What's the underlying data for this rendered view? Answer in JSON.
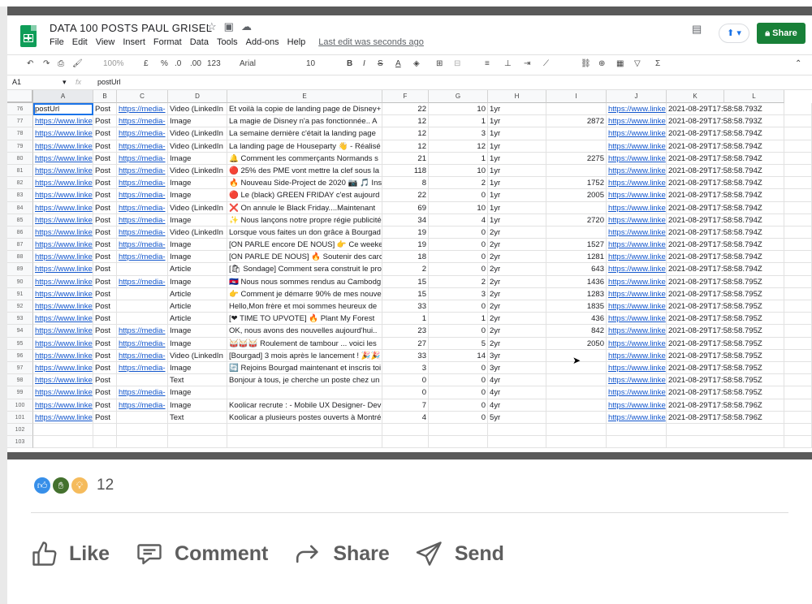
{
  "sheet": {
    "title": "DATA 100 POSTS PAUL GRISEL",
    "menu": [
      "File",
      "Edit",
      "View",
      "Insert",
      "Format",
      "Data",
      "Tools",
      "Add-ons",
      "Help"
    ],
    "last_edit": "Last edit was seconds ago",
    "share_label": "Share",
    "toolbar": {
      "zoom": "100%",
      "currency": "£",
      "percent": "%",
      "dec_less": ".0",
      "dec_more": ".00",
      "format": "123",
      "font": "Arial",
      "size": "10"
    },
    "cell_ref": "A1",
    "formula": "postUrl",
    "columns": [
      "A",
      "B",
      "C",
      "D",
      "E",
      "F",
      "G",
      "H",
      "I",
      "J",
      "K",
      "L"
    ],
    "rows": [
      {
        "n": "76",
        "a": "postUrl",
        "b": "Post",
        "c": "https://media-",
        "d": "Video (LinkedIn",
        "e": "Et voilà la copie de landing page de Disney+",
        "f": "22",
        "g": "10",
        "h": "1yr",
        "i": "",
        "j": "https://www.linke",
        "k": "2021-08-29T17:58:58.793Z"
      },
      {
        "n": "77",
        "a": "https://www.linke",
        "b": "Post",
        "c": "https://media-",
        "d": "Image",
        "e": "La magie de Disney n'a pas fonctionnée.. A",
        "f": "12",
        "g": "1",
        "h": "1yr",
        "i": "2872",
        "j": "https://www.linke",
        "k": "2021-08-29T17:58:58.793Z"
      },
      {
        "n": "78",
        "a": "https://www.linke",
        "b": "Post",
        "c": "https://media-",
        "d": "Video (LinkedIn",
        "e": "La semaine dernière c'était la landing page",
        "f": "12",
        "g": "3",
        "h": "1yr",
        "i": "",
        "j": "https://www.linke",
        "k": "2021-08-29T17:58:58.794Z"
      },
      {
        "n": "79",
        "a": "https://www.linke",
        "b": "Post",
        "c": "https://media-",
        "d": "Video (LinkedIn",
        "e": "La landing page de Houseparty 👋 - Réalisé",
        "f": "12",
        "g": "12",
        "h": "1yr",
        "i": "",
        "j": "https://www.linke",
        "k": "2021-08-29T17:58:58.794Z"
      },
      {
        "n": "80",
        "a": "https://www.linke",
        "b": "Post",
        "c": "https://media-",
        "d": "Image",
        "e": "🔔 Comment les commerçants Normands s",
        "f": "21",
        "g": "1",
        "h": "1yr",
        "i": "2275",
        "j": "https://www.linke",
        "k": "2021-08-29T17:58:58.794Z"
      },
      {
        "n": "81",
        "a": "https://www.linke",
        "b": "Post",
        "c": "https://media-",
        "d": "Video (LinkedIn",
        "e": "🔴 25% des PME vont mettre la clef sous la",
        "f": "118",
        "g": "10",
        "h": "1yr",
        "i": "",
        "j": "https://www.linke",
        "k": "2021-08-29T17:58:58.794Z"
      },
      {
        "n": "82",
        "a": "https://www.linke",
        "b": "Post",
        "c": "https://media-",
        "d": "Image",
        "e": "🔥 Nouveau Side-Project de 2020 📷 🎵 Ins",
        "f": "8",
        "g": "2",
        "h": "1yr",
        "i": "1752",
        "j": "https://www.linke",
        "k": "2021-08-29T17:58:58.794Z"
      },
      {
        "n": "83",
        "a": "https://www.linke",
        "b": "Post",
        "c": "https://media-",
        "d": "Image",
        "e": "🔴 Le (black) GREEN FRIDAY c'est aujourd",
        "f": "22",
        "g": "0",
        "h": "1yr",
        "i": "2005",
        "j": "https://www.linke",
        "k": "2021-08-29T17:58:58.794Z"
      },
      {
        "n": "84",
        "a": "https://www.linke",
        "b": "Post",
        "c": "https://media-",
        "d": "Video (LinkedIn",
        "e": "❌ On annule le Black Friday....Maintenant",
        "f": "69",
        "g": "10",
        "h": "1yr",
        "i": "",
        "j": "https://www.linke",
        "k": "2021-08-29T17:58:58.794Z"
      },
      {
        "n": "85",
        "a": "https://www.linke",
        "b": "Post",
        "c": "https://media-",
        "d": "Image",
        "e": "✨ Nous lançons notre propre régie publicité",
        "f": "34",
        "g": "4",
        "h": "1yr",
        "i": "2720",
        "j": "https://www.linke",
        "k": "2021-08-29T17:58:58.794Z"
      },
      {
        "n": "86",
        "a": "https://www.linke",
        "b": "Post",
        "c": "https://media-",
        "d": "Video (LinkedIn",
        "e": "Lorsque vous faites un don grâce à Bourgad",
        "f": "19",
        "g": "0",
        "h": "2yr",
        "i": "",
        "j": "https://www.linke",
        "k": "2021-08-29T17:58:58.794Z"
      },
      {
        "n": "87",
        "a": "https://www.linke",
        "b": "Post",
        "c": "https://media-",
        "d": "Image",
        "e": "[ON PARLE encore DE NOUS] 👉 Ce weeke",
        "f": "19",
        "g": "0",
        "h": "2yr",
        "i": "1527",
        "j": "https://www.linke",
        "k": "2021-08-29T17:58:58.794Z"
      },
      {
        "n": "88",
        "a": "https://www.linke",
        "b": "Post",
        "c": "https://media-",
        "d": "Image",
        "e": "[ON PARLE DE NOUS] 🔥 Soutenir des carc",
        "f": "18",
        "g": "0",
        "h": "2yr",
        "i": "1281",
        "j": "https://www.linke",
        "k": "2021-08-29T17:58:58.794Z"
      },
      {
        "n": "89",
        "a": "https://www.linke",
        "b": "Post",
        "c": "",
        "d": "Article",
        "e": "[🛍 Sondage] Comment sera construit le pro",
        "f": "2",
        "g": "0",
        "h": "2yr",
        "i": "643",
        "j": "https://www.linke",
        "k": "2021-08-29T17:58:58.794Z"
      },
      {
        "n": "90",
        "a": "https://www.linke",
        "b": "Post",
        "c": "https://media-",
        "d": "Image",
        "e": "🇰🇭 Nous nous sommes rendus au Cambodg",
        "f": "15",
        "g": "2",
        "h": "2yr",
        "i": "1436",
        "j": "https://www.linke",
        "k": "2021-08-29T17:58:58.795Z"
      },
      {
        "n": "91",
        "a": "https://www.linke",
        "b": "Post",
        "c": "",
        "d": "Article",
        "e": "👉 Comment je démarre 90% de mes nouve",
        "f": "15",
        "g": "3",
        "h": "2yr",
        "i": "1283",
        "j": "https://www.linke",
        "k": "2021-08-29T17:58:58.795Z"
      },
      {
        "n": "92",
        "a": "https://www.linke",
        "b": "Post",
        "c": "",
        "d": "Article",
        "e": "Hello,Mon frère et moi sommes heureux de",
        "f": "33",
        "g": "0",
        "h": "2yr",
        "i": "1835",
        "j": "https://www.linke",
        "k": "2021-08-29T17:58:58.795Z"
      },
      {
        "n": "93",
        "a": "https://www.linke",
        "b": "Post",
        "c": "",
        "d": "Article",
        "e": "[❤ TIME TO UPVOTE] 🔥 Plant My Forest",
        "f": "1",
        "g": "1",
        "h": "2yr",
        "i": "436",
        "j": "https://www.linke",
        "k": "2021-08-29T17:58:58.795Z"
      },
      {
        "n": "94",
        "a": "https://www.linke",
        "b": "Post",
        "c": "https://media-",
        "d": "Image",
        "e": "OK, nous avons des nouvelles aujourd'hui..",
        "f": "23",
        "g": "0",
        "h": "2yr",
        "i": "842",
        "j": "https://www.linke",
        "k": "2021-08-29T17:58:58.795Z"
      },
      {
        "n": "95",
        "a": "https://www.linke",
        "b": "Post",
        "c": "https://media-",
        "d": "Image",
        "e": "🥁🥁🥁 Roulement de tambour ... voici les",
        "f": "27",
        "g": "5",
        "h": "2yr",
        "i": "2050",
        "j": "https://www.linke",
        "k": "2021-08-29T17:58:58.795Z"
      },
      {
        "n": "96",
        "a": "https://www.linke",
        "b": "Post",
        "c": "https://media-",
        "d": "Video (LinkedIn",
        "e": "[Bourgad] 3 mois après le lancement ! 🎉🎉",
        "f": "33",
        "g": "14",
        "h": "3yr",
        "i": "",
        "j": "https://www.linke",
        "k": "2021-08-29T17:58:58.795Z"
      },
      {
        "n": "97",
        "a": "https://www.linke",
        "b": "Post",
        "c": "https://media-",
        "d": "Image",
        "e": "🔄 Rejoins Bourgad maintenant et inscris toi",
        "f": "3",
        "g": "0",
        "h": "3yr",
        "i": "",
        "j": "https://www.linke",
        "k": "2021-08-29T17:58:58.795Z"
      },
      {
        "n": "98",
        "a": "https://www.linke",
        "b": "Post",
        "c": "",
        "d": "Text",
        "e": "Bonjour à tous, je cherche un poste chez un",
        "f": "0",
        "g": "0",
        "h": "4yr",
        "i": "",
        "j": "https://www.linke",
        "k": "2021-08-29T17:58:58.795Z"
      },
      {
        "n": "99",
        "a": "https://www.linke",
        "b": "Post",
        "c": "https://media-",
        "d": "Image",
        "e": "",
        "f": "0",
        "g": "0",
        "h": "4yr",
        "i": "",
        "j": "https://www.linke",
        "k": "2021-08-29T17:58:58.795Z"
      },
      {
        "n": "100",
        "a": "https://www.linke",
        "b": "Post",
        "c": "https://media-",
        "d": "Image",
        "e": "Koolicar recrute : - Mobile UX Designer- Dev",
        "f": "7",
        "g": "0",
        "h": "4yr",
        "i": "",
        "j": "https://www.linke",
        "k": "2021-08-29T17:58:58.796Z"
      },
      {
        "n": "101",
        "a": "https://www.linke",
        "b": "Post",
        "c": "",
        "d": "Text",
        "e": "Koolicar a plusieurs postes ouverts à Montré",
        "f": "4",
        "g": "0",
        "h": "5yr",
        "i": "",
        "j": "https://www.linke",
        "k": "2021-08-29T17:58:58.796Z"
      },
      {
        "n": "102",
        "a": "",
        "b": "",
        "c": "",
        "d": "",
        "e": "",
        "f": "",
        "g": "",
        "h": "",
        "i": "",
        "j": "",
        "k": ""
      },
      {
        "n": "103",
        "a": "",
        "b": "",
        "c": "",
        "d": "",
        "e": "",
        "f": "",
        "g": "",
        "h": "",
        "i": "",
        "j": "",
        "k": ""
      }
    ]
  },
  "post": {
    "reaction_count": "12",
    "reaction_colors": [
      "#378fe9",
      "#44712e",
      "#f5bb5c"
    ],
    "actions": [
      {
        "label": "Like",
        "icon": "thumbs-up-icon"
      },
      {
        "label": "Comment",
        "icon": "comment-icon"
      },
      {
        "label": "Share",
        "icon": "share-arrow-icon"
      },
      {
        "label": "Send",
        "icon": "send-icon"
      }
    ]
  }
}
